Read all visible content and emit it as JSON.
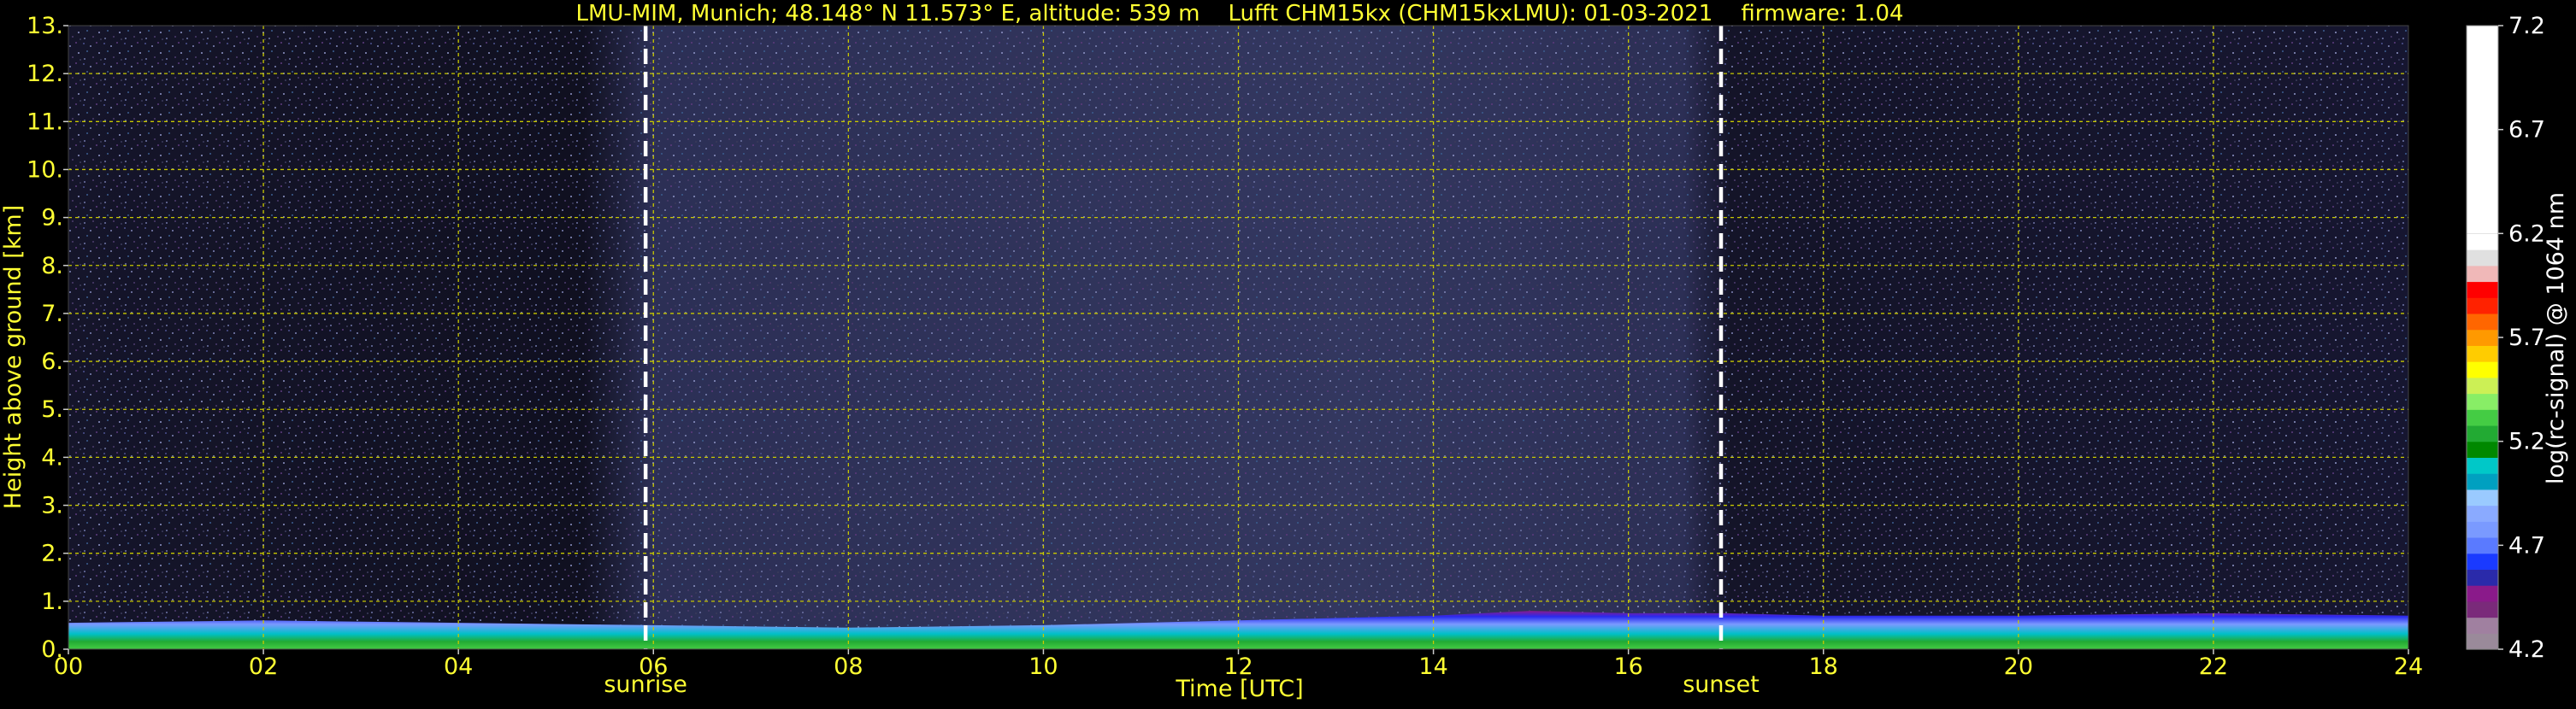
{
  "chart_data": {
    "type": "heatmap",
    "title": "LMU-MIM, Munich; 48.148° N 11.573° E, altitude: 539 m    Lufft CHM15kx (CHM15kxLMU): 01-03-2021    firmware: 1.04",
    "xlabel": "Time [UTC]",
    "ylabel": "Height above ground [km]",
    "xlim": [
      0,
      24
    ],
    "ylim": [
      0,
      13
    ],
    "x_ticks": [
      "00",
      "02",
      "04",
      "06",
      "08",
      "10",
      "12",
      "14",
      "16",
      "18",
      "20",
      "22",
      "24"
    ],
    "y_ticks": [
      "0.",
      "1.",
      "2.",
      "3.",
      "4.",
      "5.",
      "6.",
      "7.",
      "8.",
      "9.",
      "10.",
      "11.",
      "12.",
      "13."
    ],
    "grid": true,
    "markers": [
      {
        "label": "sunrise",
        "time": 5.92
      },
      {
        "label": "sunset",
        "time": 16.95
      }
    ],
    "colorbar": {
      "label": "log(rc-signal) @ 1064 nm",
      "range": [
        4.2,
        7.2
      ],
      "ticks": [
        "4.2",
        "4.7",
        "5.2",
        "5.7",
        "6.2",
        "6.7",
        "7.2"
      ],
      "colors": [
        "#9a8a9a",
        "#a080a0",
        "#7a2a7a",
        "#8a1a8a",
        "#2a2aaa",
        "#1a3aff",
        "#5a7aff",
        "#7a9aff",
        "#8aaaff",
        "#9acaff",
        "#00a0c0",
        "#00c8c8",
        "#008800",
        "#22aa33",
        "#44cc44",
        "#88ee66",
        "#ccf055",
        "#ffff00",
        "#ffcc00",
        "#ff9900",
        "#ff6600",
        "#ff2200",
        "#ff0000",
        "#f0b8b8",
        "#e0e0e0",
        "#ffffff"
      ]
    },
    "boundary_layer": [
      {
        "time": 0,
        "top_km": 0.55
      },
      {
        "time": 2,
        "top_km": 0.6
      },
      {
        "time": 4,
        "top_km": 0.55
      },
      {
        "time": 6,
        "top_km": 0.5
      },
      {
        "time": 8,
        "top_km": 0.45
      },
      {
        "time": 10,
        "top_km": 0.5
      },
      {
        "time": 12,
        "top_km": 0.6
      },
      {
        "time": 14,
        "top_km": 0.7
      },
      {
        "time": 15,
        "top_km": 0.8
      },
      {
        "time": 16,
        "top_km": 0.75
      },
      {
        "time": 17,
        "top_km": 0.75
      },
      {
        "time": 18,
        "top_km": 0.7
      },
      {
        "time": 20,
        "top_km": 0.7
      },
      {
        "time": 22,
        "top_km": 0.75
      },
      {
        "time": 24,
        "top_km": 0.7
      }
    ]
  }
}
